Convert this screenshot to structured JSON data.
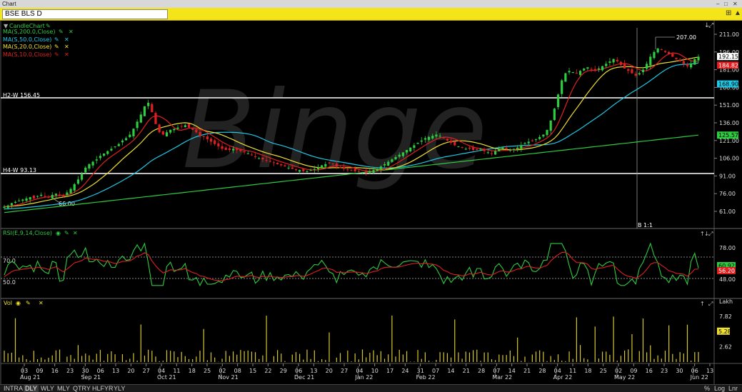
{
  "window": {
    "title": "Chart"
  },
  "symbol": {
    "text": "BSE BLS D"
  },
  "indicators": [
    {
      "label": "CandleChart",
      "color": "#2ecc40"
    },
    {
      "label": "MA(S,200.0,Close)",
      "color": "#2ecc40"
    },
    {
      "label": "MA(S,50.0,Close)",
      "color": "#1ec8e6"
    },
    {
      "label": "MA(S,20.0,Close)",
      "color": "#f0e030"
    },
    {
      "label": "MA(S,10.0,Close)",
      "color": "#e02020"
    }
  ],
  "rsi_label": "RSI(E,9,14,Close)",
  "vol_label": "Vol",
  "annotations": {
    "h2": "H2-W 156.45",
    "h4": "H4-W 93.13",
    "low": "66.00",
    "high": "207.00",
    "cursor": "B 1:1",
    "rsi70": "70.0",
    "rsi50": "50.0",
    "vol_unit": "Lakh"
  },
  "price_axis": [
    "211.00",
    "196.00",
    "181.00",
    "166.00",
    "151.00",
    "136.00",
    "121.00",
    "106.00",
    "91.00",
    "76.00",
    "61.00"
  ],
  "price_tags": [
    {
      "text": "192.15",
      "bg": "#ffffff",
      "fg": "#000000"
    },
    {
      "text": "184.82",
      "bg": "#e02020",
      "fg": "#ffffff"
    },
    {
      "text": "168.90",
      "bg": "#1ec8e6",
      "fg": "#000000"
    },
    {
      "text": "125.57",
      "bg": "#2ecc40",
      "fg": "#000000"
    }
  ],
  "rsi_axis": [
    "78.00",
    "48.00"
  ],
  "rsi_tags": [
    {
      "text": "60.92",
      "bg": "#2ecc40",
      "fg": "#000000"
    },
    {
      "text": "56.20",
      "bg": "#e02020",
      "fg": "#ffffff"
    }
  ],
  "vol_axis": [
    "7.82",
    "2.62"
  ],
  "vol_tag": {
    "text": "5.28",
    "bg": "#f0e030",
    "fg": "#000000"
  },
  "date_ticks": [
    "03",
    "09",
    "16",
    "23",
    "30",
    "06",
    "13",
    "20",
    "27",
    "04",
    "11",
    "18",
    "25",
    "02",
    "08",
    "15",
    "22",
    "29",
    "06",
    "13",
    "20",
    "27",
    "04",
    "10",
    "17",
    "24",
    "31",
    "07",
    "14",
    "21",
    "28",
    "07",
    "14",
    "21",
    "28",
    "04",
    "11",
    "18",
    "25",
    "02",
    "09",
    "16",
    "23",
    "30",
    "06",
    "13"
  ],
  "month_labels": [
    "Aug 21",
    "Sep 21",
    "Oct 21",
    "Nov 21",
    "Dec 21",
    "Jan 22",
    "Feb 22",
    "Mar 22",
    "Apr 22",
    "May 22",
    "Jun 22"
  ],
  "timeframes": [
    "INTRA",
    "DLY",
    "WLY",
    "MLY",
    "QTRY",
    "HLFYR",
    "YLY"
  ],
  "active_timeframe": "DLY",
  "scale_buttons": [
    "%",
    "Log",
    "Lnr"
  ],
  "watermark": "Binge",
  "chart_data": {
    "type": "candlestick",
    "title": "BSE BLS D",
    "period": "Aug 2021 - Jun 2022",
    "ylim": [
      58,
      217
    ],
    "close": [
      65,
      66,
      68,
      69,
      70,
      71,
      72,
      73,
      72,
      74,
      75,
      74,
      73,
      75,
      76,
      75,
      74,
      77,
      80,
      84,
      88,
      93,
      98,
      101,
      103,
      105,
      108,
      110,
      112,
      114,
      116,
      118,
      121,
      123,
      126,
      131,
      137,
      143,
      150,
      153,
      145,
      135,
      128,
      126,
      128,
      130,
      131,
      132,
      133,
      134,
      132,
      130,
      128,
      125,
      124,
      122,
      120,
      118,
      116,
      114,
      113,
      113,
      114,
      113,
      112,
      111,
      110,
      109,
      107,
      106,
      105,
      104,
      103,
      102,
      101,
      100,
      99,
      98,
      97,
      96,
      96,
      95,
      95,
      96,
      97,
      98,
      100,
      101,
      102,
      101,
      99,
      98,
      97,
      96,
      96,
      95,
      95,
      94,
      94,
      95,
      96,
      97,
      99,
      101,
      103,
      105,
      107,
      109,
      111,
      113,
      115,
      117,
      119,
      121,
      123,
      124,
      125,
      126,
      125,
      123,
      121,
      119,
      117,
      116,
      115,
      114,
      114,
      113,
      113,
      114,
      112,
      111,
      110,
      112,
      114,
      115,
      114,
      113,
      114,
      115,
      117,
      119,
      120,
      121,
      122,
      124,
      126,
      130,
      138,
      148,
      160,
      172,
      178,
      180,
      179,
      178,
      180,
      182,
      183,
      181,
      180,
      182,
      184,
      186,
      188,
      190,
      188,
      185,
      182,
      180,
      178,
      176,
      178,
      181,
      186,
      192,
      196,
      199,
      198,
      196,
      194,
      192,
      190,
      188,
      186,
      184,
      186,
      190,
      192
    ],
    "series": [
      {
        "name": "MA(S,200.0,Close)",
        "color": "#2ecc40"
      },
      {
        "name": "MA(S,50.0,Close)",
        "color": "#1ec8e6"
      },
      {
        "name": "MA(S,20.0,Close)",
        "color": "#f0e030"
      },
      {
        "name": "MA(S,10.0,Close)",
        "color": "#e02020"
      }
    ],
    "levels": [
      {
        "label": "H2-W 156.45",
        "value": 156.45
      },
      {
        "label": "H4-W 93.13",
        "value": 93.13
      }
    ],
    "last_values": {
      "close": 192.15,
      "ma10": 184.82,
      "ma50": 168.9,
      "ma200": 125.57,
      "rsi": 60.92,
      "rsi_signal": 56.2,
      "volume": 5.28
    }
  }
}
